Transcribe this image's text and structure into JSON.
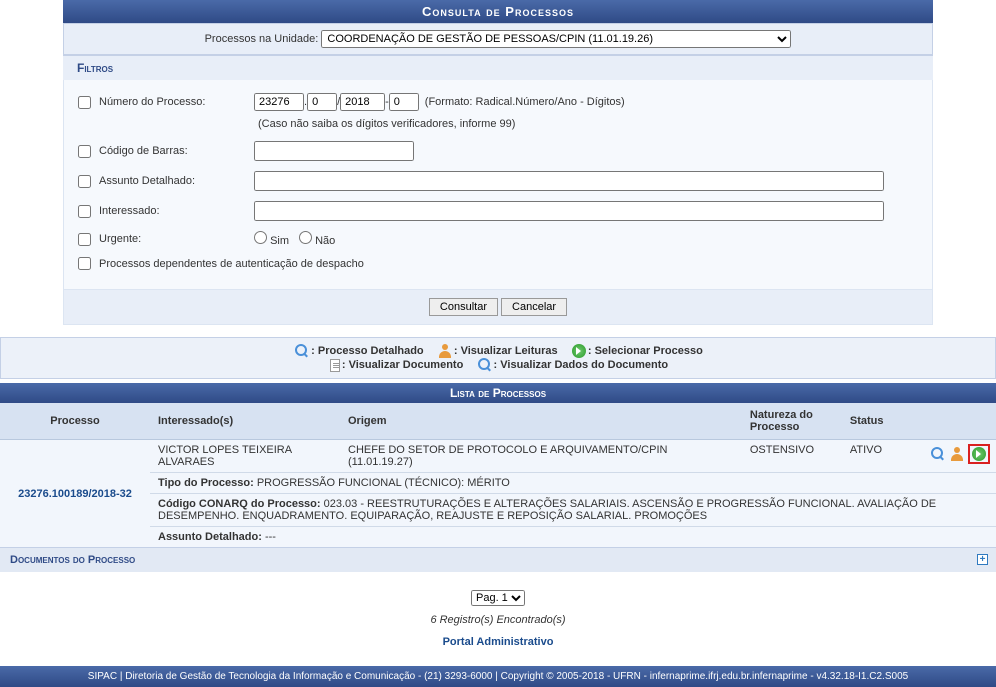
{
  "header": {
    "title": "Consulta de Processos"
  },
  "unit": {
    "label": "Processos na Unidade:",
    "selected": "COORDENAÇÃO DE GESTÃO DE PESSOAS/CPIN (11.01.19.26)"
  },
  "filtros": {
    "heading": "Filtros",
    "numero_label": "Número do Processo:",
    "numero_radical": "23276",
    "numero_seq": "0",
    "numero_ano": "2018",
    "numero_dig": "0",
    "numero_hint": "(Formato: Radical.Número/Ano - Dígitos)",
    "numero_subhint": "(Caso não saiba os dígitos verificadores, informe 99)",
    "codigo_barras_label": "Código de Barras:",
    "assunto_label": "Assunto Detalhado:",
    "interessado_label": "Interessado:",
    "urgente_label": "Urgente:",
    "urgente_sim": "Sim",
    "urgente_nao": "Não",
    "dependentes_label": "Processos dependentes de autenticação de despacho",
    "btn_consultar": "Consultar",
    "btn_cancelar": "Cancelar"
  },
  "legend": {
    "processo_detalhado": ": Processo Detalhado",
    "visualizar_leituras": ": Visualizar Leituras",
    "selecionar_processo": ": Selecionar Processo",
    "visualizar_documento": ": Visualizar Documento",
    "visualizar_dados_documento": ": Visualizar Dados do Documento"
  },
  "list": {
    "title": "Lista de Processos",
    "cols": {
      "processo": "Processo",
      "interessados": "Interessado(s)",
      "origem": "Origem",
      "natureza": "Natureza do Processo",
      "status": "Status"
    },
    "row": {
      "processo": "23276.100189/2018-32",
      "interessado": "VICTOR LOPES TEIXEIRA ALVARAES",
      "origem": "CHEFE DO SETOR DE PROTOCOLO E ARQUIVAMENTO/CPIN (11.01.19.27)",
      "natureza": "OSTENSIVO",
      "status": "ATIVO",
      "tipo_label": "Tipo do Processo:",
      "tipo_value": "PROGRESSÃO FUNCIONAL (TÉCNICO): MÉRITO",
      "conarq_label": "Código CONARQ do Processo:",
      "conarq_value": "023.03 - REESTRUTURAÇÕES E ALTERAÇÕES SALARIAIS. ASCENSÃO E PROGRESSÃO FUNCIONAL. AVALIAÇÃO DE DESEMPENHO. ENQUADRAMENTO. EQUIPARAÇÃO, REAJUSTE E REPOSIÇÃO SALARIAL. PROMOÇÕES",
      "assunto_label": "Assunto Detalhado:",
      "assunto_value": "---",
      "documentos_heading": "Documentos do Processo"
    }
  },
  "pager": {
    "current": "Pag. 1"
  },
  "result_count": "6 Registro(s) Encontrado(s)",
  "portal_link": "Portal Administrativo",
  "footer": "SIPAC | Diretoria de Gestão de Tecnologia da Informação e Comunicação - (21) 3293-6000 | Copyright © 2005-2018 - UFRN - infernaprime.ifrj.edu.br.infernaprime - v4.32.18-I1.C2.S005"
}
